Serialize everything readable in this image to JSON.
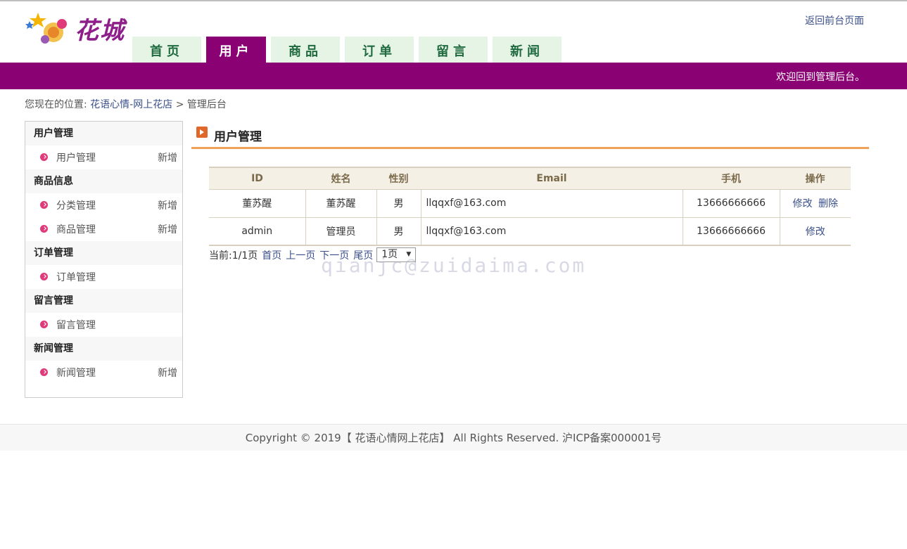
{
  "header": {
    "logo_text": "花城",
    "back_link": "返回前台页面",
    "nav": [
      {
        "label": "首页",
        "active": false
      },
      {
        "label": "用户",
        "active": true
      },
      {
        "label": "商品",
        "active": false
      },
      {
        "label": "订单",
        "active": false
      },
      {
        "label": "留言",
        "active": false
      },
      {
        "label": "新闻",
        "active": false
      }
    ],
    "welcome": "欢迎回到管理后台。"
  },
  "breadcrumb": {
    "prefix": "您现在的位置:",
    "link": "花语心情-网上花店",
    "separator": ">",
    "current": "管理后台"
  },
  "sidebar": {
    "groups": [
      {
        "title": "用户管理",
        "items": [
          {
            "label": "用户管理",
            "add": "新增"
          }
        ]
      },
      {
        "title": "商品信息",
        "items": [
          {
            "label": "分类管理",
            "add": "新增"
          },
          {
            "label": "商品管理",
            "add": "新增"
          }
        ]
      },
      {
        "title": "订单管理",
        "items": [
          {
            "label": "订单管理",
            "add": ""
          }
        ]
      },
      {
        "title": "留言管理",
        "items": [
          {
            "label": "留言管理",
            "add": ""
          }
        ]
      },
      {
        "title": "新闻管理",
        "items": [
          {
            "label": "新闻管理",
            "add": "新增"
          }
        ]
      }
    ]
  },
  "main": {
    "title": "用户管理",
    "table": {
      "headers": [
        "ID",
        "姓名",
        "性别",
        "Email",
        "手机",
        "操作"
      ],
      "rows": [
        {
          "id": "董苏醒",
          "name": "董苏醒",
          "gender": "男",
          "email": "llqqxf@163.com",
          "phone": "13666666666",
          "edit": "修改",
          "delete": "删除"
        },
        {
          "id": "admin",
          "name": "管理员",
          "gender": "男",
          "email": "llqqxf@163.com",
          "phone": "13666666666",
          "edit": "修改",
          "delete": ""
        }
      ]
    },
    "pager": {
      "current": "当前:1/1页",
      "first": "首页",
      "prev": "上一页",
      "next": "下一页",
      "last": "尾页",
      "select_value": "1页"
    },
    "watermark": "qianjc@zuidaima.com"
  },
  "footer": {
    "copyright": "Copyright © 2019【 花语心情网上花店】 All Rights Reserved. 沪ICP备案000001号"
  },
  "colors": {
    "brand_purple": "#8a0173",
    "tab_green_bg": "#e6f4e6",
    "tab_green_text": "#1f6a3f",
    "accent_orange": "#f0a25a"
  }
}
